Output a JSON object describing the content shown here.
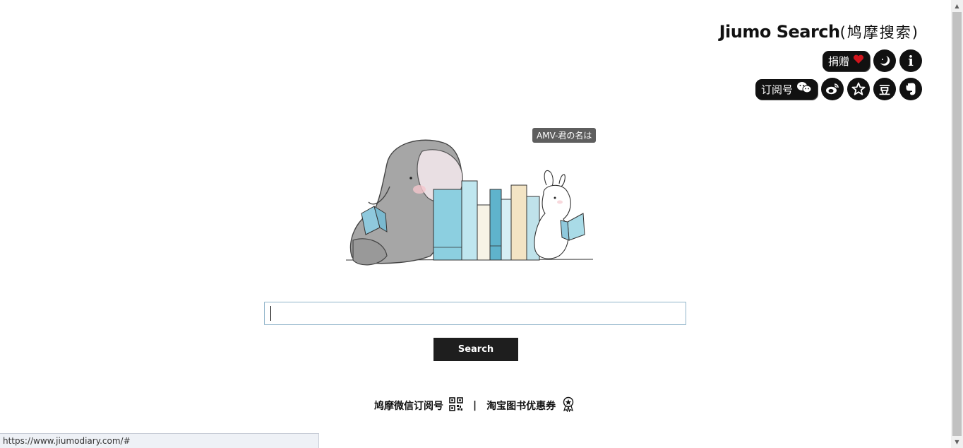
{
  "header": {
    "brand_en": "Jiumo Search",
    "brand_cn": "(鸠摩搜索)"
  },
  "buttons": {
    "donate_label": "捐赠",
    "subscribe_label": "订阅号",
    "douban_label": "豆",
    "info_label": "i"
  },
  "tooltip": {
    "text": "AMV-君の名は"
  },
  "search": {
    "value": "",
    "placeholder": "",
    "button_label": "Search"
  },
  "footer": {
    "wechat_link": "鸠摩微信订阅号",
    "separator": "|",
    "taobao_link": "淘宝图书优惠券"
  },
  "status_bar": {
    "url": "https://www.jiumodiary.com/#"
  },
  "colors": {
    "button_bg": "#111111",
    "heart": "#d0141c",
    "input_border": "#8fb3c9",
    "search_button_bg": "#1e1e1e",
    "tooltip_bg": "#5e5e5e"
  },
  "icons": {
    "donate": "heart-icon",
    "night_mode": "moon-icon",
    "info": "info-icon",
    "subscribe": "wechat-icon",
    "weibo": "weibo-icon",
    "favorite": "star-icon",
    "douban": "douban-icon",
    "evernote": "evernote-icon",
    "wechat_qr": "qr-code-icon",
    "coupon": "coupon-badge-icon"
  }
}
